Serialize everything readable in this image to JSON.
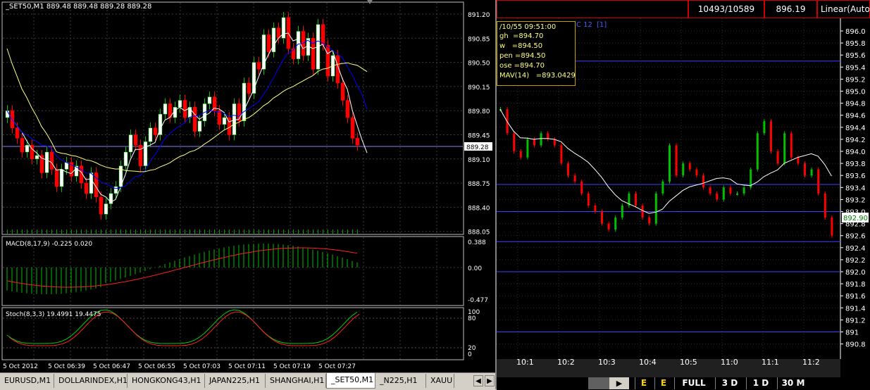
{
  "left_chart": {
    "header": "_SET50,M1  889.48 889.48 889.28 889.28",
    "price_ticks": [
      "891.20",
      "890.85",
      "890.50",
      "890.15",
      "889.80",
      "889.45",
      "889.10",
      "888.75",
      "888.40",
      "888.05"
    ],
    "current_price": "889.28",
    "macd_label": "MACD(8,17,9) -0.225 0.020",
    "macd_ticks": [
      "0.388",
      "0.00",
      "-0.477"
    ],
    "stoch_label": "Stoch(8,3,3) 19.4991 19.4475",
    "stoch_ticks": [
      "100",
      "80",
      "20",
      "0"
    ],
    "time_labels": [
      "5 Oct 2012",
      "5 Oct 06:39",
      "5 Oct 06:47",
      "5 Oct 06:55",
      "5 Oct 07:03",
      "5 Oct 07:11",
      "5 Oct 07:19",
      "5 Oct 07:27"
    ],
    "colors": {
      "up": "#00c000",
      "down": "#ff0000",
      "ma_fast": "#ffffff",
      "ma_slow": "#ffff80",
      "ma_blue": "#0000ff",
      "grid": "#404040"
    }
  },
  "tabs": [
    "EURUSD,M1",
    "DOLLARINDEX,H1",
    "HONGKONG43,H1",
    "JAPAN225,H1",
    "SHANGHAI,H1",
    "_SET50,M1",
    "_N225,H1",
    "XAUU"
  ],
  "active_tab": "_SET50,M1",
  "right_chart": {
    "ratio": "10493/10589",
    "price": "896.19",
    "scale_mode": "Linear(Auto",
    "info_time": "/10/55 09:51:00",
    "info_suffix": "C 12",
    "info_bracket": "[1]",
    "info_lines": [
      "gh  =894.70",
      "w   =894.50",
      "pen =894.50",
      "ose =894.70",
      "MAV(14)   =893.0429"
    ],
    "price_ticks": [
      "896.0",
      "895.8",
      "895.6",
      "895.4",
      "895.2",
      "895.0",
      "894.8",
      "894.6",
      "894.4",
      "894.2",
      "894.0",
      "893.8",
      "893.6",
      "893.4",
      "893.2",
      "893.0",
      "892.8",
      "892.6",
      "892.4",
      "892.2",
      "892.0",
      "891.8",
      "891.6",
      "891.4",
      "891.2",
      "891",
      "890.8"
    ],
    "current_price": "892.90",
    "time_labels": [
      "10:1",
      "10:2",
      "10:3",
      "10:4",
      "10:5",
      "11:0",
      "11:1",
      "11:2"
    ],
    "bottom_buttons": [
      "E",
      "E",
      "FULL",
      "3 D",
      "1 D",
      "30 M"
    ],
    "colors": {
      "up": "#00c000",
      "down": "#ff0000",
      "level": "#4040ff",
      "info": "#ffff80"
    }
  }
}
